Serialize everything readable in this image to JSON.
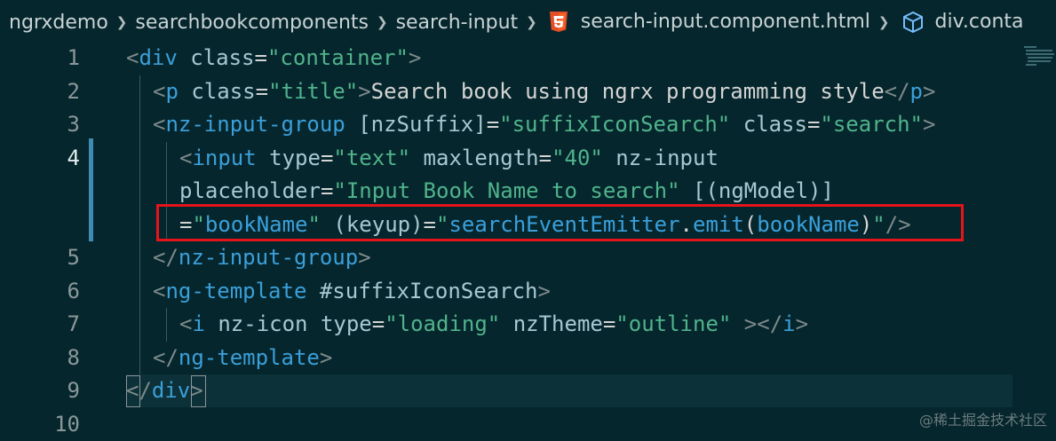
{
  "breadcrumb": {
    "items": [
      {
        "label": "ngrxdemo",
        "icon": null
      },
      {
        "label": "searchbookcomponents",
        "icon": null
      },
      {
        "label": "search-input",
        "icon": null
      },
      {
        "label": "search-input.component.html",
        "icon": "html5-icon"
      },
      {
        "label": "div.conta",
        "icon": "cube-icon"
      }
    ]
  },
  "colors": {
    "background": "#05262c",
    "tag": "#3b9fd9",
    "string": "#50b38c",
    "highlight_border": "#e5141b",
    "modified_bar": "#3f8bb2"
  },
  "editor": {
    "line_numbers": [
      "1",
      "2",
      "3",
      "4",
      "",
      "",
      "5",
      "6",
      "7",
      "8",
      "9",
      "10"
    ],
    "active_line": "4",
    "lines": [
      [
        [
          "p",
          "<"
        ],
        [
          "t",
          "div"
        ],
        [
          "a",
          " class"
        ],
        [
          "o",
          "="
        ],
        [
          "s",
          "\"container\""
        ],
        [
          "p",
          ">"
        ]
      ],
      [
        [
          "p",
          "<"
        ],
        [
          "t",
          "p"
        ],
        [
          "a",
          " class"
        ],
        [
          "o",
          "="
        ],
        [
          "s",
          "\"title\""
        ],
        [
          "p",
          ">"
        ],
        [
          "x",
          "Search book using ngrx programming style"
        ],
        [
          "p",
          "</"
        ],
        [
          "t",
          "p"
        ],
        [
          "p",
          ">"
        ]
      ],
      [
        [
          "p",
          "<"
        ],
        [
          "t",
          "nz-input-group"
        ],
        [
          "a",
          " [nzSuffix]"
        ],
        [
          "o",
          "="
        ],
        [
          "s",
          "\"suffixIconSearch\""
        ],
        [
          "a",
          " class"
        ],
        [
          "o",
          "="
        ],
        [
          "s",
          "\"search\""
        ],
        [
          "p",
          ">"
        ]
      ],
      [
        [
          "p",
          "<"
        ],
        [
          "t",
          "input"
        ],
        [
          "a",
          " type"
        ],
        [
          "o",
          "="
        ],
        [
          "s",
          "\"text\""
        ],
        [
          "a",
          " maxlength"
        ],
        [
          "o",
          "="
        ],
        [
          "s",
          "\"40\""
        ],
        [
          "a",
          " nz-input"
        ]
      ],
      [
        [
          "a",
          "placeholder"
        ],
        [
          "o",
          "="
        ],
        [
          "s",
          "\"Input Book Name to search\""
        ],
        [
          "a",
          " [(ngModel)]"
        ]
      ],
      [
        [
          "o",
          "="
        ],
        [
          "s",
          "\""
        ],
        [
          "v",
          "bookName"
        ],
        [
          "s",
          "\""
        ],
        [
          "a",
          " (keyup)"
        ],
        [
          "o",
          "="
        ],
        [
          "s",
          "\""
        ],
        [
          "v",
          "searchEventEmitter"
        ],
        [
          "x",
          "."
        ],
        [
          "v",
          "emit"
        ],
        [
          "x",
          "("
        ],
        [
          "v",
          "bookName"
        ],
        [
          "x",
          ")"
        ],
        [
          "s",
          "\""
        ],
        [
          "p",
          "/>"
        ]
      ],
      [
        [
          "p",
          "</"
        ],
        [
          "t",
          "nz-input-group"
        ],
        [
          "p",
          ">"
        ]
      ],
      [
        [
          "p",
          "<"
        ],
        [
          "t",
          "ng-template"
        ],
        [
          "a",
          " #suffixIconSearch"
        ],
        [
          "p",
          ">"
        ]
      ],
      [
        [
          "p",
          "<"
        ],
        [
          "t",
          "i"
        ],
        [
          "a",
          " nz-icon type"
        ],
        [
          "o",
          "="
        ],
        [
          "s",
          "\"loading\""
        ],
        [
          "a",
          " nzTheme"
        ],
        [
          "o",
          "="
        ],
        [
          "s",
          "\"outline\""
        ],
        [
          "p",
          " ></"
        ],
        [
          "t",
          "i"
        ],
        [
          "p",
          ">"
        ]
      ],
      [
        [
          "p",
          "</"
        ],
        [
          "t",
          "ng-template"
        ],
        [
          "p",
          ">"
        ]
      ],
      [
        [
          "p",
          "</"
        ],
        [
          "t",
          "div"
        ],
        [
          "p",
          ">"
        ]
      ],
      []
    ]
  },
  "watermark": "@稀土掘金技术社区"
}
